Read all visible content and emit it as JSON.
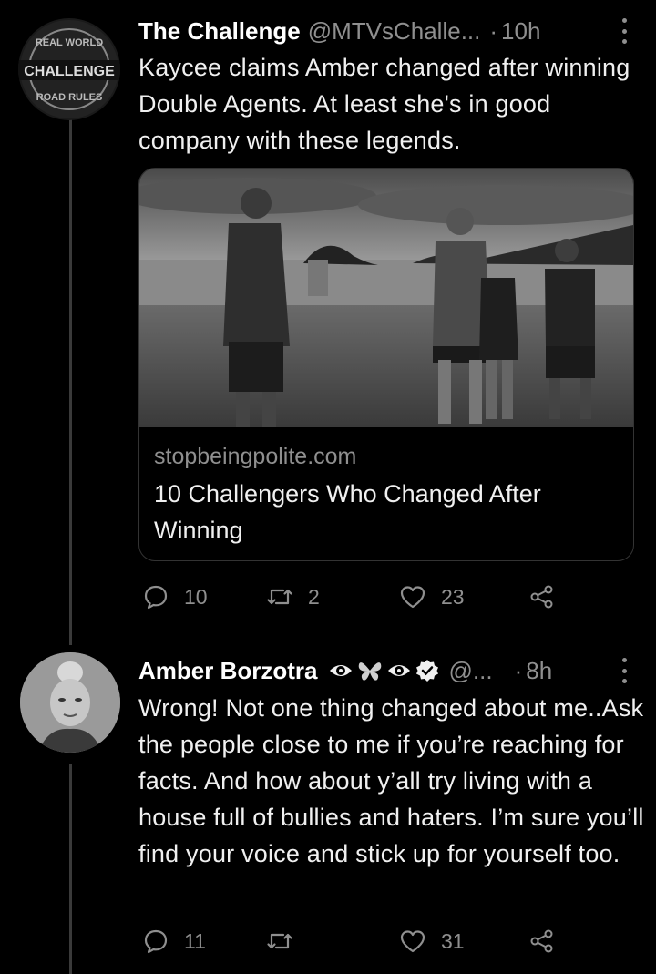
{
  "tweet1": {
    "name": "The Challenge",
    "handle": "@MTVsChalle...",
    "sep": "·",
    "time": "10h",
    "avatar_text": {
      "top": "REAL WORLD",
      "mid": "CHALLENGE",
      "bottom": "ROAD RULES"
    },
    "text": "Kaycee claims Amber changed after winning Double Agents. At least she's in good company with these legends.",
    "card": {
      "domain": "stopbeingpolite.com",
      "title": "10 Challengers Who Changed After Winning"
    },
    "actions": {
      "replies": "10",
      "retweets": "2",
      "likes": "23"
    }
  },
  "tweet2": {
    "name": "Amber Borzotra",
    "handle": "@...",
    "sep": "·",
    "time": "8h",
    "text": "Wrong! Not one thing changed about me..Ask the people close to me if you’re reaching for facts. And how about y’all try living with a house full of bullies and haters. I’m sure you’ll find your voice and stick up for yourself too.",
    "actions": {
      "replies": "11",
      "retweets": "",
      "likes": "31"
    }
  },
  "icons": [
    "reply-icon",
    "retweet-icon",
    "like-icon",
    "share-icon",
    "more-icon",
    "verified-icon",
    "eye-emoji-icon",
    "butterfly-emoji-icon"
  ]
}
